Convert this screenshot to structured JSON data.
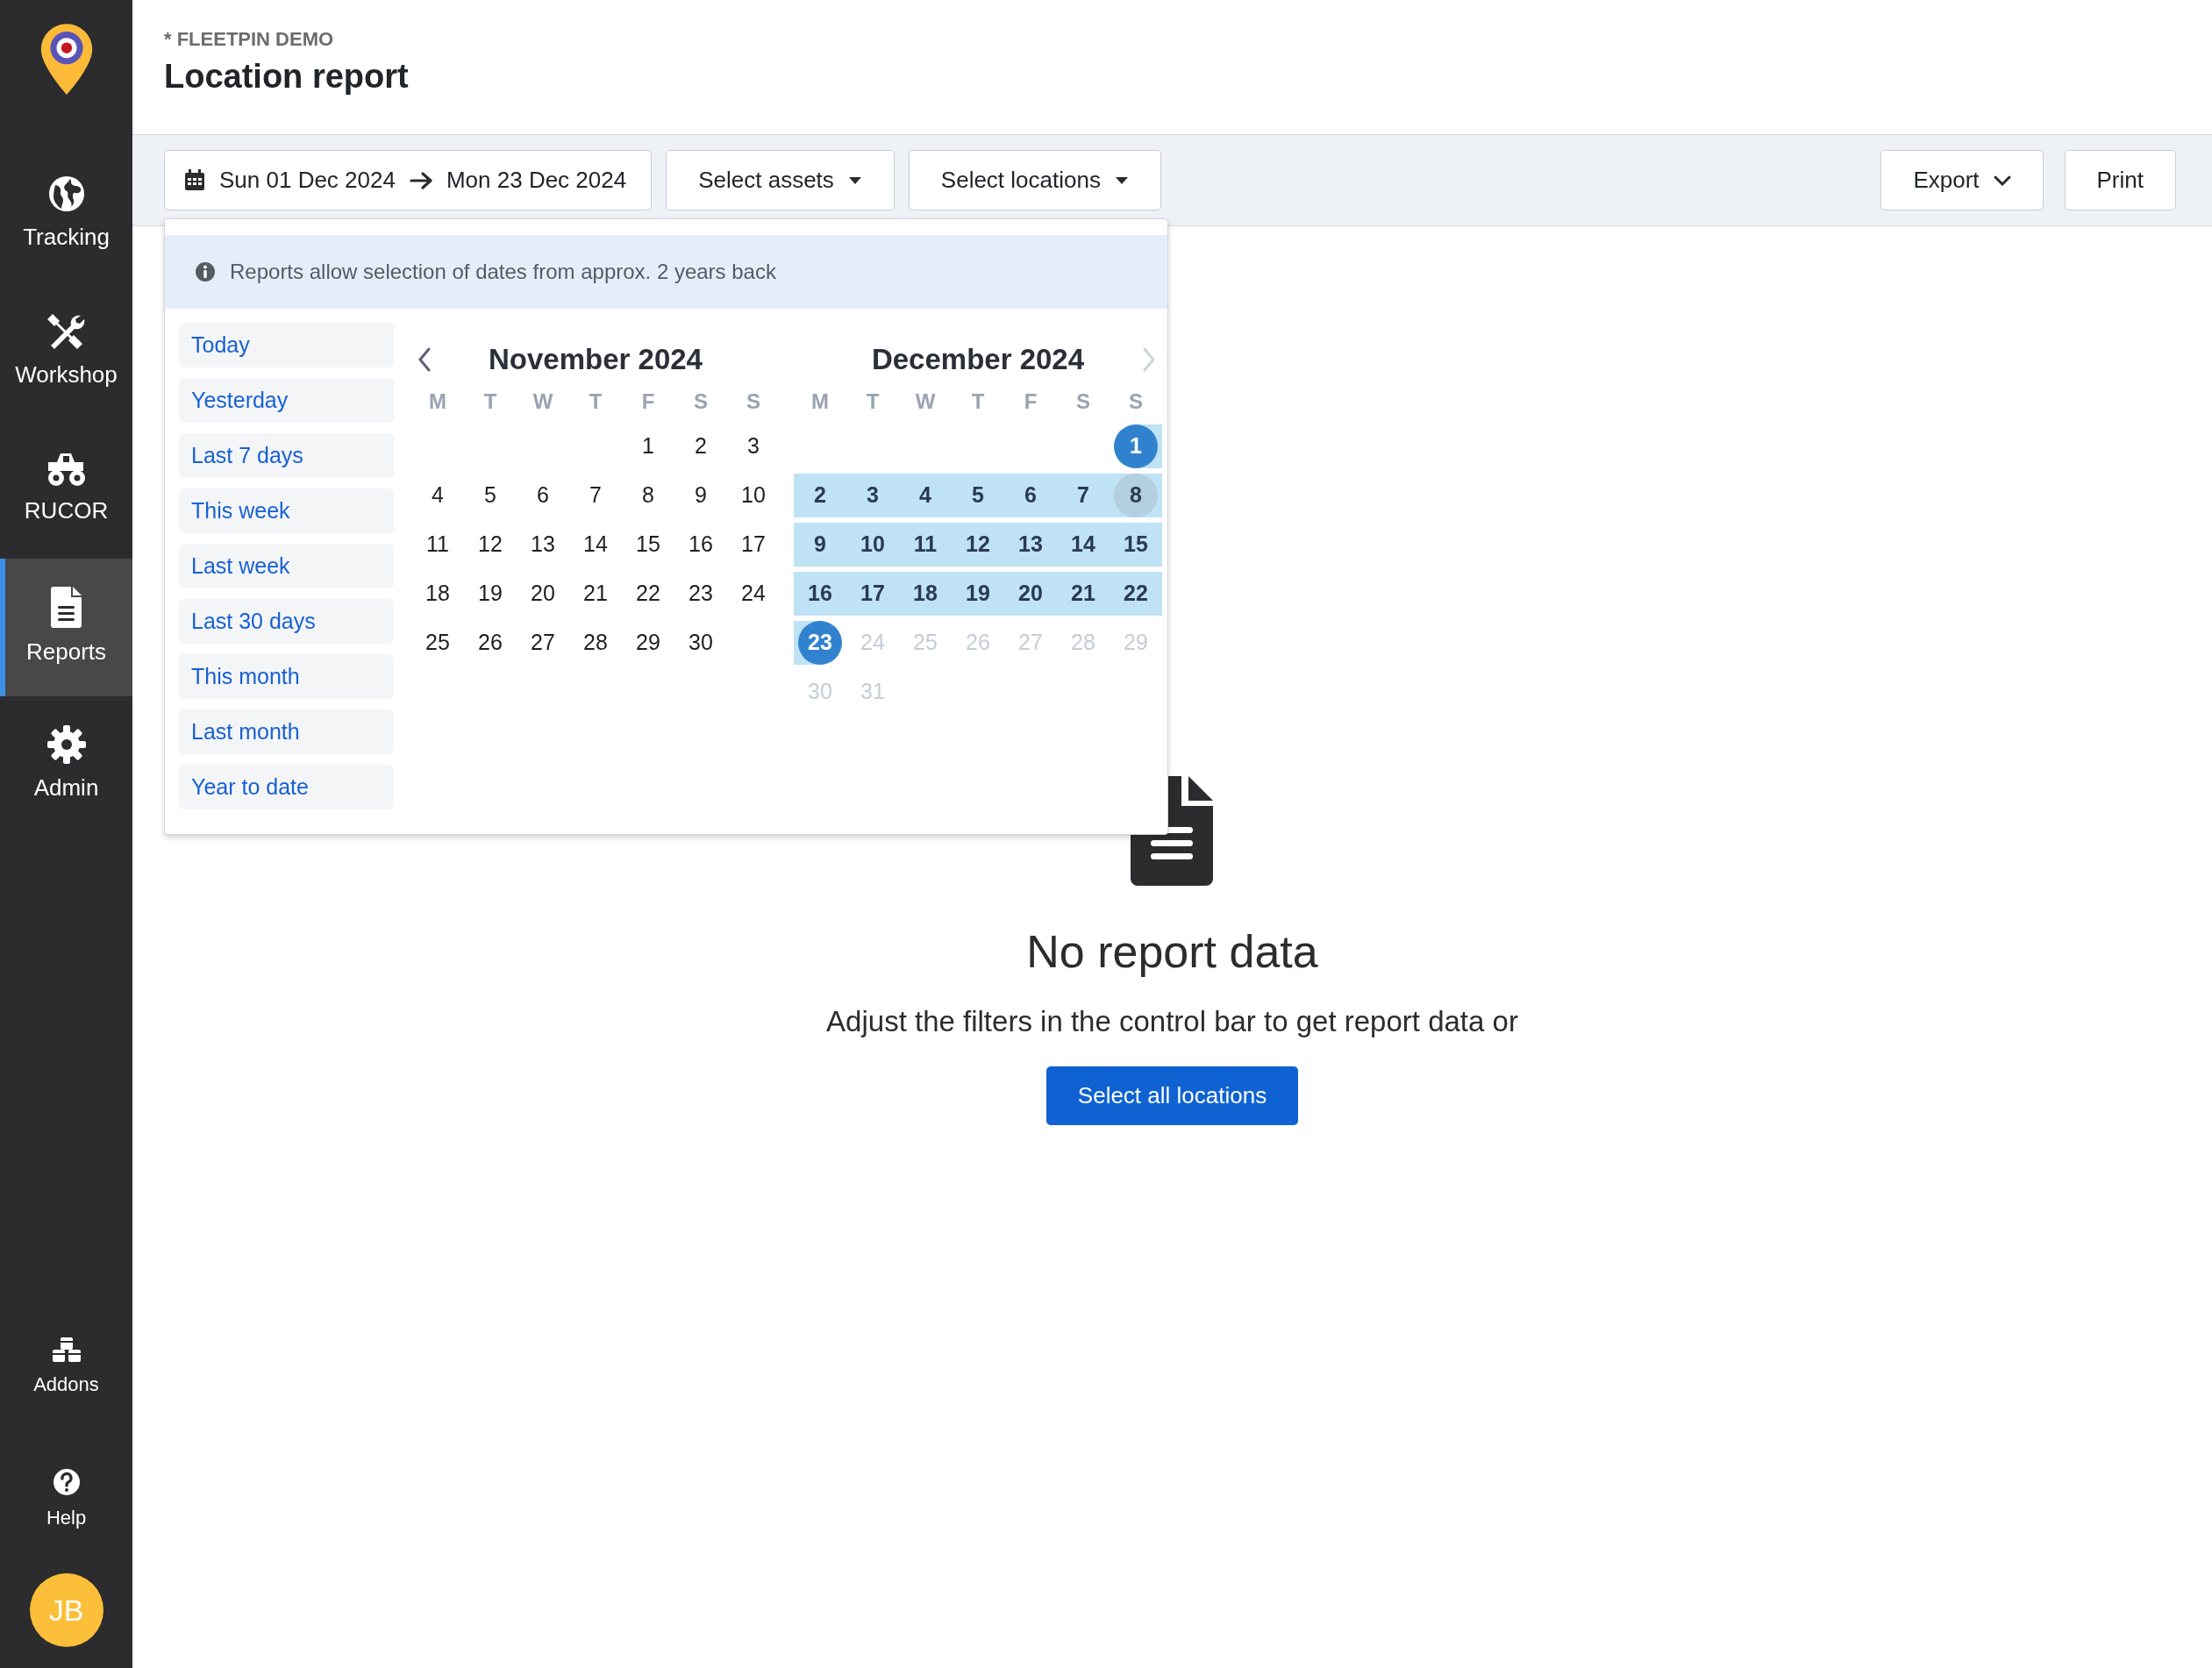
{
  "sidebar": {
    "items": [
      {
        "label": "Tracking",
        "selected": false
      },
      {
        "label": "Workshop",
        "selected": false
      },
      {
        "label": "RUCOR",
        "selected": false
      },
      {
        "label": "Reports",
        "selected": true
      },
      {
        "label": "Admin",
        "selected": false
      }
    ],
    "bottom_items": [
      {
        "label": "Addons"
      },
      {
        "label": "Help"
      }
    ],
    "avatar": "JB"
  },
  "header": {
    "organization": "* FLEETPIN DEMO",
    "title": "Location report"
  },
  "toolbar": {
    "date_range": {
      "start": "Sun 01 Dec 2024",
      "end": "Mon 23 Dec 2024"
    },
    "left_buttons": [
      {
        "label": "Select assets",
        "kind": "caret"
      },
      {
        "label": "Select locations",
        "kind": "caret"
      }
    ],
    "right_buttons": [
      {
        "label": "Export",
        "kind": "chevron"
      },
      {
        "label": "Print",
        "kind": "plain"
      }
    ]
  },
  "date_picker": {
    "notice": "Reports allow selection of dates from approx. 2 years back",
    "presets": [
      {
        "label": "Today",
        "selected": false
      },
      {
        "label": "Yesterday",
        "selected": false
      },
      {
        "label": "Last 7 days",
        "selected": false
      },
      {
        "label": "This week",
        "selected": false
      },
      {
        "label": "Last week",
        "selected": false
      },
      {
        "label": "Last 30 days",
        "selected": false
      },
      {
        "label": "This month",
        "selected": false
      },
      {
        "label": "Last month",
        "selected": false
      },
      {
        "label": "Year to date",
        "selected": false
      }
    ],
    "prev_disabled": false,
    "next_disabled": true,
    "months": [
      {
        "title": "November 2024",
        "weekdays": [
          "M",
          "T",
          "W",
          "T",
          "F",
          "S",
          "S"
        ],
        "weeks": [
          [
            {
              "text": "1",
              "kind": "normal"
            },
            {
              "text": "2",
              "kind": "normal"
            },
            {
              "text": "3",
              "kind": "normal"
            }
          ],
          [
            {
              "text": "4",
              "kind": "normal"
            },
            {
              "text": "5",
              "kind": "normal"
            },
            {
              "text": "6",
              "kind": "normal"
            },
            {
              "text": "7",
              "kind": "normal"
            },
            {
              "text": "8",
              "kind": "normal"
            },
            {
              "text": "9",
              "kind": "normal"
            },
            {
              "text": "10",
              "kind": "normal"
            }
          ],
          [
            {
              "text": "11",
              "kind": "normal"
            },
            {
              "text": "12",
              "kind": "normal"
            },
            {
              "text": "13",
              "kind": "normal"
            },
            {
              "text": "14",
              "kind": "normal"
            },
            {
              "text": "15",
              "kind": "normal"
            },
            {
              "text": "16",
              "kind": "normal"
            },
            {
              "text": "17",
              "kind": "normal"
            }
          ],
          [
            {
              "text": "18",
              "kind": "normal"
            },
            {
              "text": "19",
              "kind": "normal"
            },
            {
              "text": "20",
              "kind": "normal"
            },
            {
              "text": "21",
              "kind": "normal"
            },
            {
              "text": "22",
              "kind": "normal"
            },
            {
              "text": "23",
              "kind": "normal"
            },
            {
              "text": "24",
              "kind": "normal"
            }
          ],
          [
            {
              "text": "25",
              "kind": "normal"
            },
            {
              "text": "26",
              "kind": "normal"
            },
            {
              "text": "27",
              "kind": "normal"
            },
            {
              "text": "28",
              "kind": "normal"
            },
            {
              "text": "29",
              "kind": "normal"
            },
            {
              "text": "30",
              "kind": "normal"
            }
          ]
        ]
      },
      {
        "title": "December 2024",
        "weekdays": [
          "M",
          "T",
          "W",
          "T",
          "F",
          "S",
          "S"
        ],
        "weeks": [
          [
            {
              "text": "1",
              "kind": "range-start"
            }
          ],
          [
            {
              "text": "2",
              "kind": "range"
            },
            {
              "text": "3",
              "kind": "range"
            },
            {
              "text": "4",
              "kind": "range"
            },
            {
              "text": "5",
              "kind": "range"
            },
            {
              "text": "6",
              "kind": "range"
            },
            {
              "text": "7",
              "kind": "range"
            },
            {
              "text": "8",
              "kind": "range-hover"
            }
          ],
          [
            {
              "text": "9",
              "kind": "range"
            },
            {
              "text": "10",
              "kind": "range"
            },
            {
              "text": "11",
              "kind": "range"
            },
            {
              "text": "12",
              "kind": "range"
            },
            {
              "text": "13",
              "kind": "range"
            },
            {
              "text": "14",
              "kind": "range"
            },
            {
              "text": "15",
              "kind": "range"
            }
          ],
          [
            {
              "text": "16",
              "kind": "range"
            },
            {
              "text": "17",
              "kind": "range"
            },
            {
              "text": "18",
              "kind": "range"
            },
            {
              "text": "19",
              "kind": "range"
            },
            {
              "text": "20",
              "kind": "range"
            },
            {
              "text": "21",
              "kind": "range"
            },
            {
              "text": "22",
              "kind": "range"
            }
          ],
          [
            {
              "text": "23",
              "kind": "range-end"
            },
            {
              "text": "24",
              "kind": "disabled"
            },
            {
              "text": "25",
              "kind": "disabled"
            },
            {
              "text": "26",
              "kind": "disabled"
            },
            {
              "text": "27",
              "kind": "disabled"
            },
            {
              "text": "28",
              "kind": "disabled"
            },
            {
              "text": "29",
              "kind": "disabled"
            }
          ],
          [
            {
              "text": "30",
              "kind": "disabled"
            },
            {
              "text": "31",
              "kind": "disabled"
            }
          ]
        ]
      }
    ]
  },
  "empty_state": {
    "title": "No report data",
    "message": "Adjust the filters in the control bar to get report data or",
    "button": "Select all locations"
  }
}
